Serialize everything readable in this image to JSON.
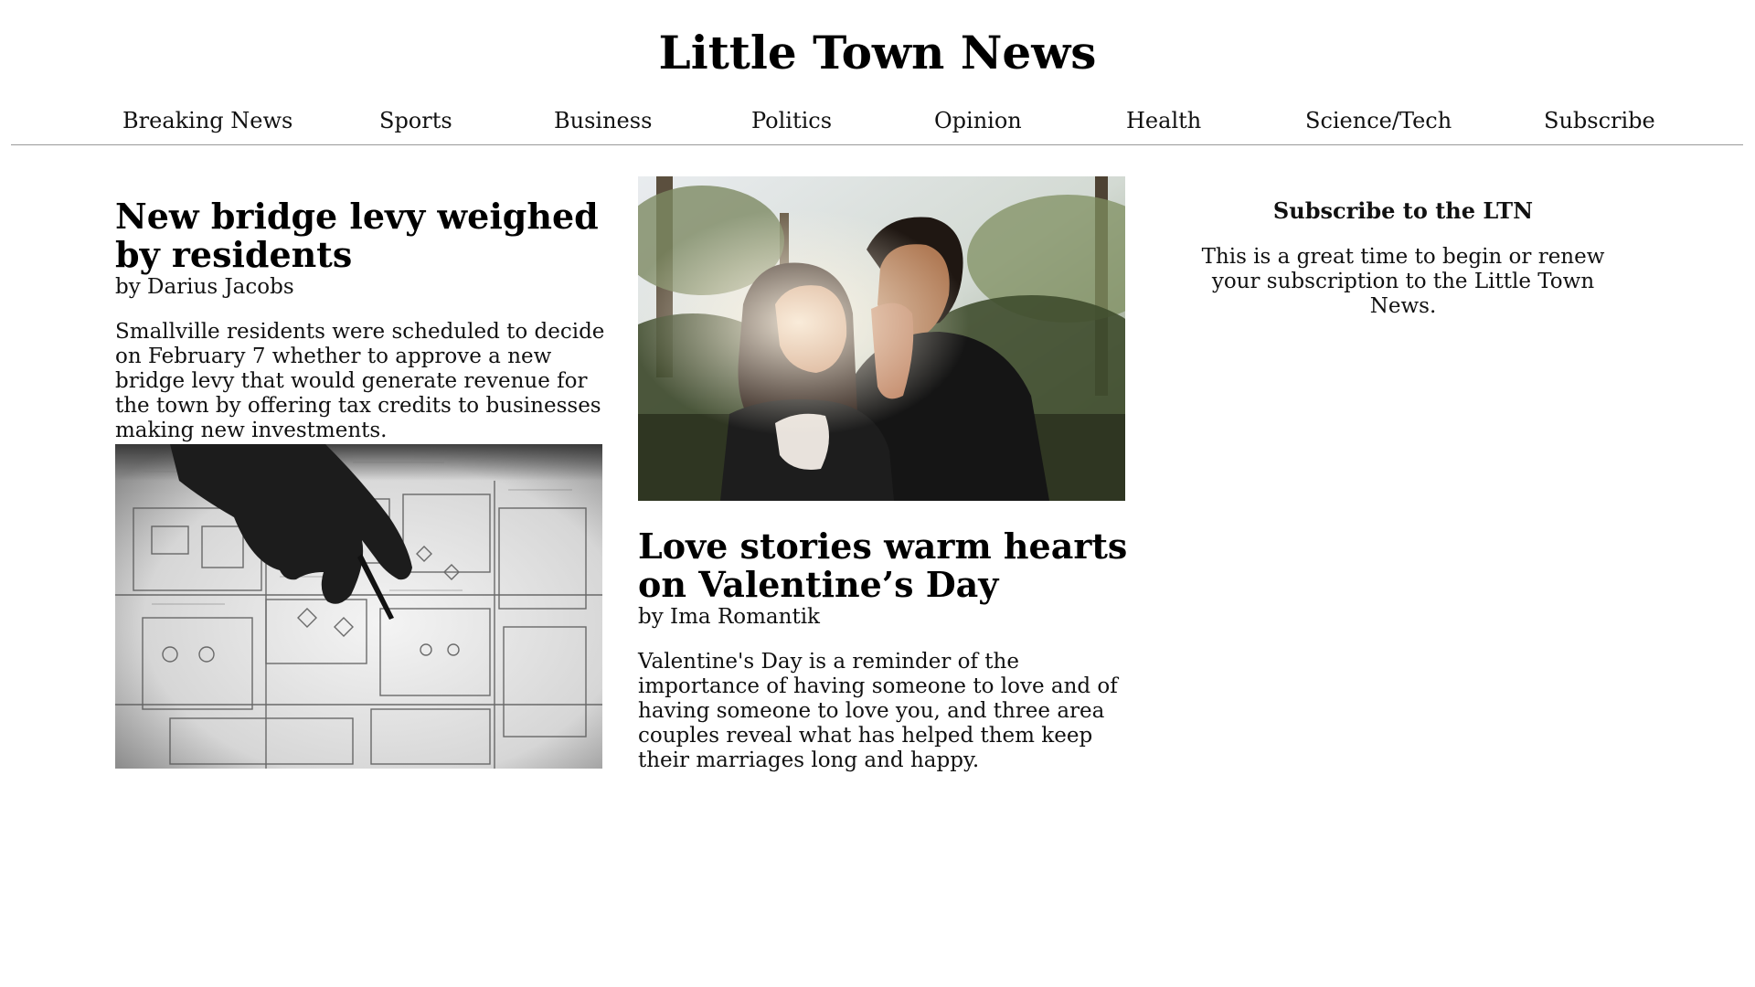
{
  "site": {
    "title": "Little Town News"
  },
  "nav": {
    "items": [
      {
        "label": "Breaking News"
      },
      {
        "label": "Sports"
      },
      {
        "label": "Business"
      },
      {
        "label": "Politics"
      },
      {
        "label": "Opinion"
      },
      {
        "label": "Health"
      },
      {
        "label": "Science/Tech"
      },
      {
        "label": "Subscribe"
      }
    ]
  },
  "articles": [
    {
      "headline": "New bridge levy weighed by residents",
      "byline": "by Darius Jacobs",
      "summary": "Smallville residents were scheduled to decide on February 7 whether to approve a new bridge levy that would generate revenue for the town by offering tax credits to businesses making new investments.",
      "image": "blueprint-photo"
    },
    {
      "headline": "Love stories warm hearts on Valentine’s Day",
      "byline": "by Ima Romantik",
      "summary": "Valentine's Day is a reminder of the importance of having someone to love and of having someone to love you, and three area couples reveal what has helped them keep their marriages long and happy.",
      "image": "couple-photo"
    }
  ],
  "sidebar": {
    "title": "Subscribe to the LTN",
    "text": "This is a great time to begin or renew your subscription to the Little Town News."
  }
}
